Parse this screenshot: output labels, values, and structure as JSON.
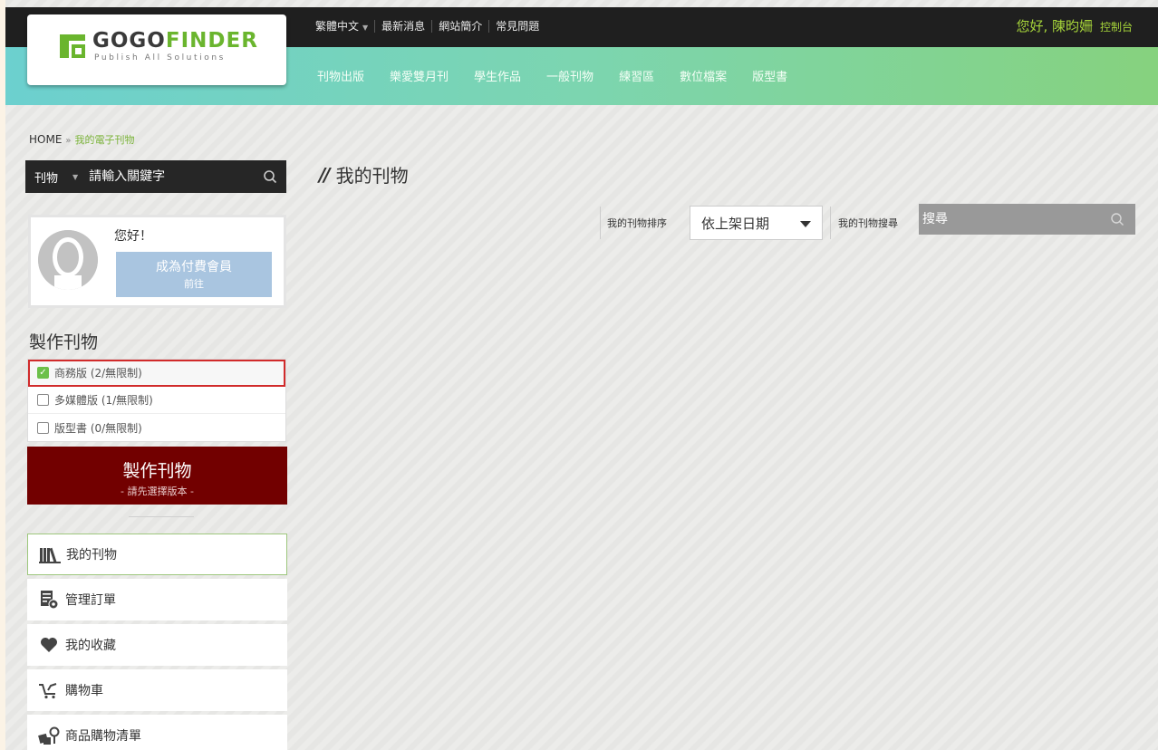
{
  "brand": {
    "name_part1": "GOGO",
    "name_part2": "FINDER",
    "tagline": "Publish All Solutions",
    "colors": {
      "green": "#6ab52e",
      "dark": "#3a3a3a"
    }
  },
  "topnav": {
    "language": "繁體中文",
    "items": [
      "最新消息",
      "網站簡介",
      "常見問題"
    ]
  },
  "user": {
    "greeting": "您好, 陳昀姍",
    "console_label": "控制台"
  },
  "catnav": [
    "刊物出版",
    "樂愛雙月刊",
    "學生作品",
    "一般刊物",
    "練習區",
    "數位檔案",
    "版型書"
  ],
  "breadcrumb": {
    "home": "HOME",
    "separator": "»",
    "current": "我的電子刊物"
  },
  "search": {
    "type": "刊物",
    "placeholder": "請輸入關鍵字"
  },
  "profile": {
    "hello": "您好！",
    "upgrade_label": "成為付費會員",
    "upgrade_sub": "前往"
  },
  "make": {
    "title": "製作刊物",
    "versions": [
      {
        "label": "商務版 (2/無限制)",
        "checked": true
      },
      {
        "label": "多媒體版 (1/無限制)",
        "checked": false
      },
      {
        "label": "版型書 (0/無限制)",
        "checked": false
      }
    ],
    "button_label": "製作刊物",
    "button_sub": "- 請先選擇版本 -",
    "button_color": "#720000"
  },
  "menu": [
    {
      "label": "我的刊物",
      "icon": "books-icon"
    },
    {
      "label": "管理訂單",
      "icon": "order-manage-icon"
    },
    {
      "label": "我的收藏",
      "icon": "heart-icon"
    },
    {
      "label": "購物車",
      "icon": "cart-icon"
    },
    {
      "label": "商品購物清單",
      "icon": "shopping-list-icon"
    }
  ],
  "main": {
    "title": "我的刊物",
    "sort_label": "我的刊物排序",
    "sort_value": "依上架日期",
    "search_label": "我的刊物搜尋",
    "search_placeholder": "搜尋"
  }
}
